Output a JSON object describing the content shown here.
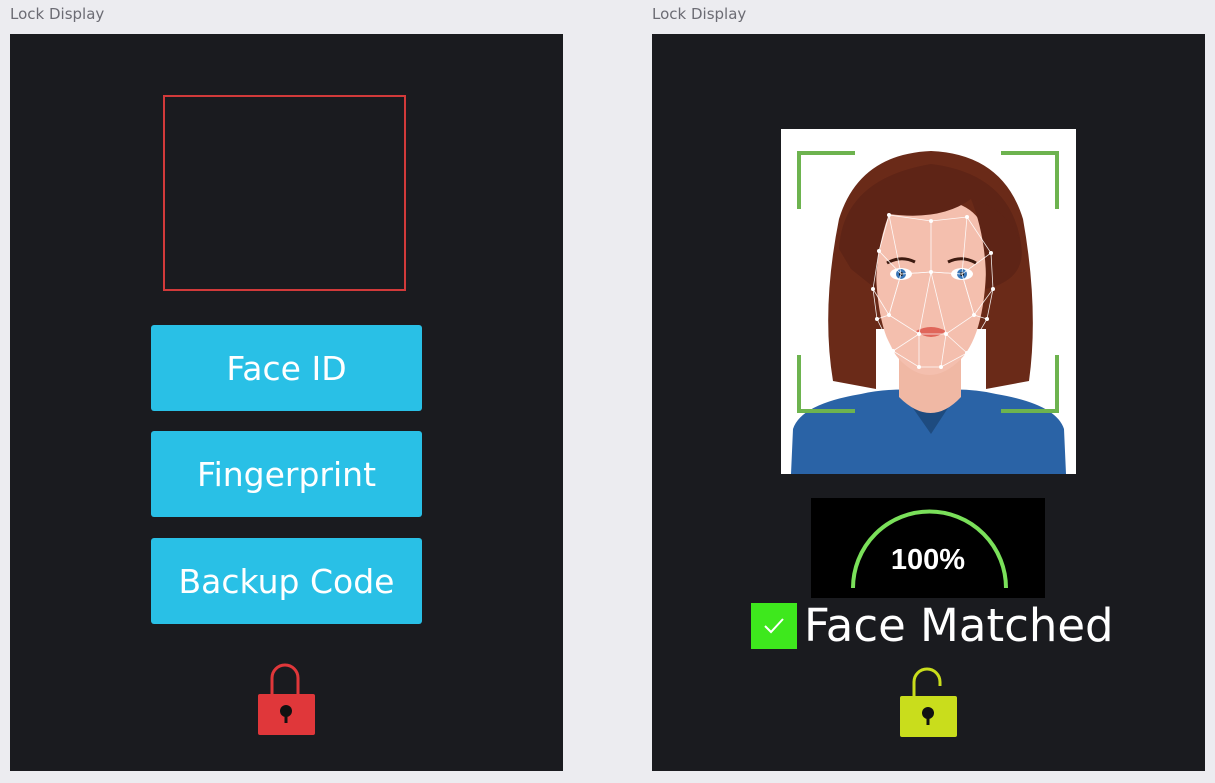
{
  "frames": [
    {
      "label": "Lock Display",
      "buttons": [
        {
          "label": "Face ID"
        },
        {
          "label": "Fingerprint"
        },
        {
          "label": "Backup Code"
        }
      ],
      "lock_icon": "padlock-locked-icon",
      "lock_color": "#e0373a",
      "face_box_color": "#d23a3a"
    },
    {
      "label": "Lock Display",
      "gauge": {
        "value": 100,
        "text": "100%",
        "color": "#7ae05a"
      },
      "status": {
        "text": "Face Matched",
        "icon": "check-icon",
        "icon_color": "#3ee81d"
      },
      "lock_icon": "padlock-unlocked-icon",
      "lock_color": "#c9dd1c"
    }
  ],
  "colors": {
    "button_bg": "#29c0e6",
    "frame_bg": "#1a1b1f",
    "page_bg": "#ececf0"
  }
}
